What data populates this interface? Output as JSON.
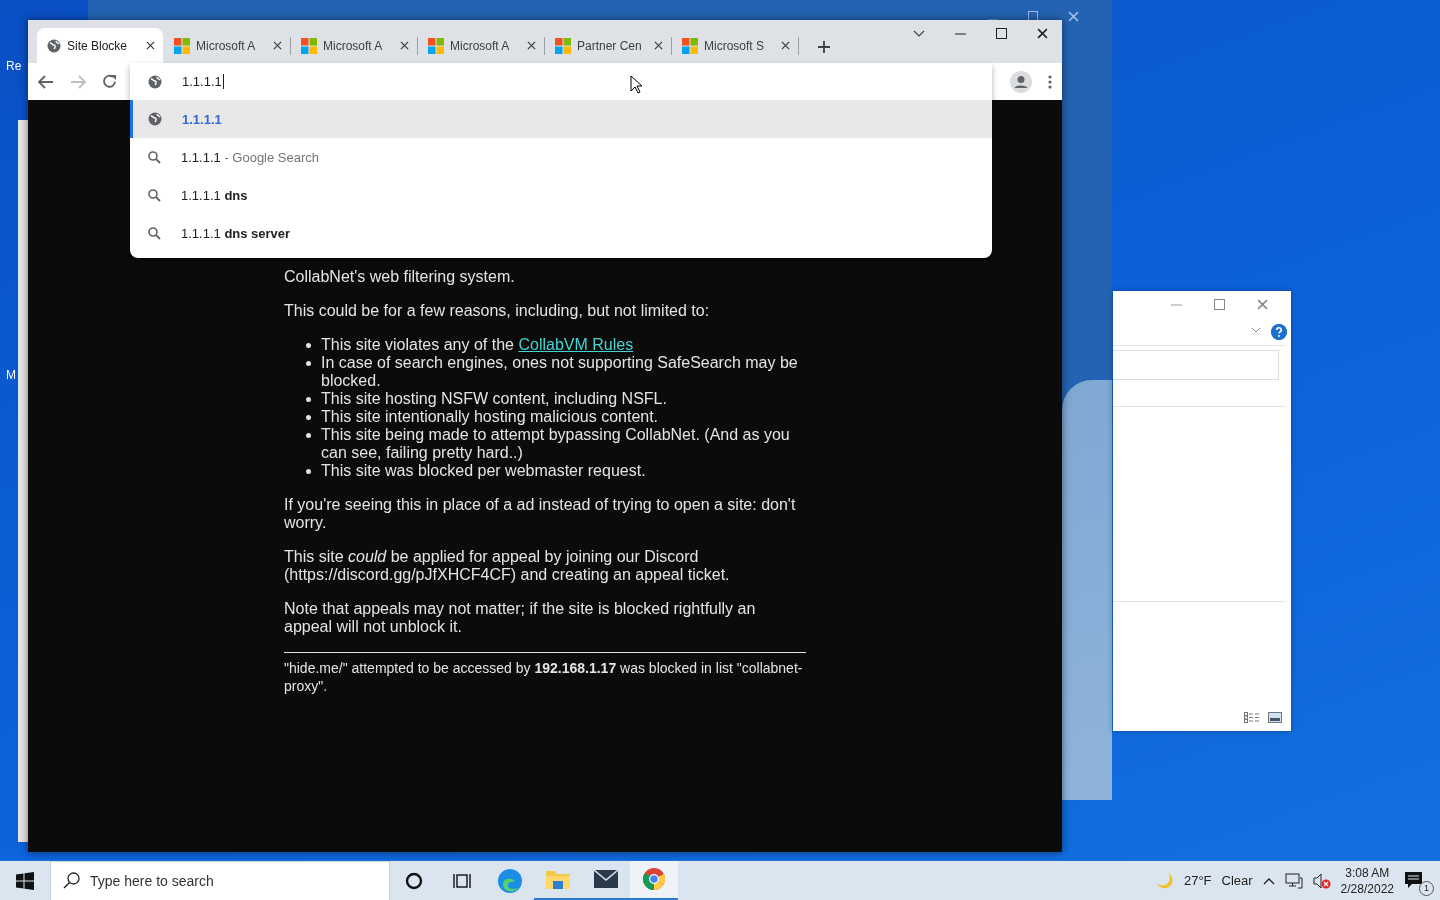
{
  "desktop": {
    "icon_labels": [
      "Re",
      "M"
    ]
  },
  "browser": {
    "tabs": [
      {
        "title": "Site Blocke",
        "kind": "globe",
        "selected": true
      },
      {
        "title": "Microsoft A",
        "kind": "windows",
        "selected": false
      },
      {
        "title": "Microsoft A",
        "kind": "windows",
        "selected": false
      },
      {
        "title": "Microsoft A",
        "kind": "windows",
        "selected": false
      },
      {
        "title": "Partner Cen",
        "kind": "windows",
        "selected": false
      },
      {
        "title": "Microsoft S",
        "kind": "windows",
        "selected": false
      }
    ],
    "back": {
      "disabled": false
    },
    "forward": {
      "disabled": true
    },
    "address": {
      "value": "1.1.1.1"
    },
    "suggestions": [
      {
        "kind": "url",
        "text": "1.1.1.1",
        "selected": true
      },
      {
        "kind": "search",
        "text": "1.1.1.1",
        "suffix": " - Google Search",
        "selected": false
      },
      {
        "kind": "search",
        "text": "1.1.1.1 **dns**",
        "selected": false
      },
      {
        "kind": "search",
        "text": "1.1.1.1 **dns server**",
        "selected": false
      }
    ]
  },
  "page": {
    "intro": "CollabNet's web filtering system.",
    "lead": "This could be for a few reasons, including, but not limited to:",
    "reasons": [
      {
        "text": "This site violates any of the ",
        "link": "CollabVM Rules"
      },
      {
        "text": "In case of search engines, ones not supporting SafeSearch may be blocked."
      },
      {
        "text": "This site hosting NSFW content, including NSFL."
      },
      {
        "text": "This site intentionally hosting malicious content."
      },
      {
        "text": "This site being made to attempt bypassing CollabNet. (And as you can see, failing pretty hard..)"
      },
      {
        "text": "This site was blocked per webmaster request."
      }
    ],
    "paragraphs": [
      "If you're seeing this in place of a ad instead of trying to open a site: don't worry.",
      "This site *could* be applied for appeal by joining our Discord (https://discord.gg/pJfXHCF4CF) and creating an appeal ticket.",
      "Note that appeals may not matter; if the site is blocked rightfully an appeal will not unblock it."
    ],
    "footer": "\"hide.me/\" attempted to be accessed by **192.168.1.17** was blocked in list \"collabnet-proxy\"."
  },
  "taskbar": {
    "search_placeholder": "Type here to search",
    "apps": [
      {
        "kind": "edge",
        "running": false,
        "selected": false
      },
      {
        "kind": "explorer",
        "running": true,
        "selected": false
      },
      {
        "kind": "mail",
        "running": true,
        "selected": false
      },
      {
        "kind": "chrome",
        "running": true,
        "selected": true
      }
    ],
    "weather": {
      "temperature": "27°F",
      "condition": "Clear"
    },
    "volume": {
      "muted": true
    },
    "clock": {
      "time": "3:08 AM",
      "date": "2/28/2022"
    },
    "notifications": {
      "count": "1"
    }
  }
}
